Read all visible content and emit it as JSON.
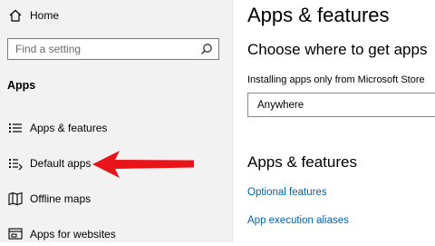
{
  "sidebar": {
    "home_label": "Home",
    "search_placeholder": "Find a setting",
    "section_title": "Apps",
    "items": [
      {
        "label": "Apps & features",
        "icon": "apps-features-icon"
      },
      {
        "label": "Default apps",
        "icon": "default-apps-icon"
      },
      {
        "label": "Offline maps",
        "icon": "offline-maps-icon"
      },
      {
        "label": "Apps for websites",
        "icon": "apps-for-websites-icon"
      }
    ]
  },
  "main": {
    "title": "Apps & features",
    "source_heading": "Choose where to get apps",
    "source_description": "Installing apps only from Microsoft Store",
    "source_selected": "Anywhere",
    "apps_heading": "Apps & features",
    "links": [
      "Optional features",
      "App execution aliases"
    ]
  },
  "colors": {
    "link": "#0063b1",
    "arrow": "#e8141a",
    "sidebar_bg": "#f2f2f2"
  }
}
